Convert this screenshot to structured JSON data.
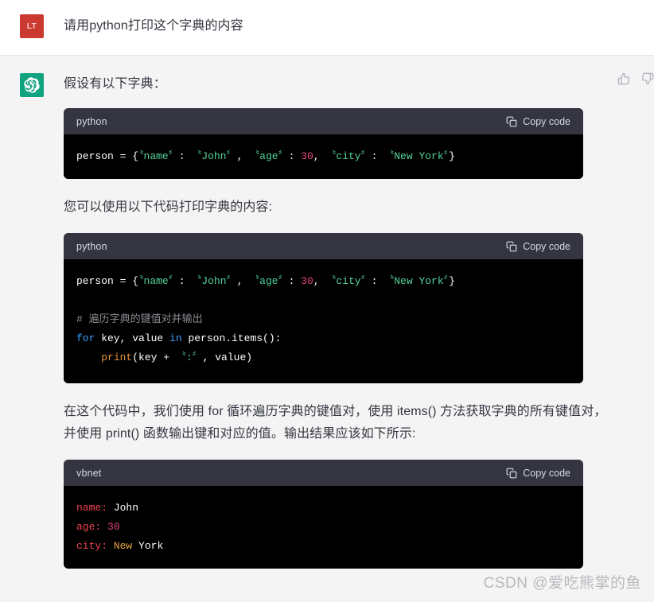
{
  "conversation": {
    "user_message": {
      "avatar_initials": "LT",
      "avatar_color": "#cb3a31",
      "text": "请用python打印这个字典的内容"
    },
    "assistant_message": {
      "avatar_color": "#10a37f",
      "avatar_icon": "openai-logo-icon",
      "intro_text": "假设有以下字典：",
      "middle_text": "您可以使用以下代码打印字典的内容:",
      "explanation_text": "在这个代码中，我们使用 for 循环遍历字典的键值对，使用 items() 方法获取字典的所有键值对，并使用 print() 函数输出键和对应的值。输出结果应该如下所示:",
      "feedback": {
        "thumbs_up": "thumbs-up-icon",
        "thumbs_down": "thumbs-down-icon"
      }
    }
  },
  "code_blocks": [
    {
      "language": "python",
      "copy_label": "Copy code",
      "copy_icon": "clipboard-icon",
      "lines": [
        [
          {
            "t": "person = {",
            "c": "tok-plain"
          },
          {
            "t": "〝name〞",
            "c": "tok-str"
          },
          {
            "t": ": ",
            "c": "tok-plain"
          },
          {
            "t": "〝John〞",
            "c": "tok-str"
          },
          {
            "t": ", ",
            "c": "tok-plain"
          },
          {
            "t": "〝age〞",
            "c": "tok-str"
          },
          {
            "t": ": ",
            "c": "tok-plain"
          },
          {
            "t": "30",
            "c": "tok-num"
          },
          {
            "t": ", ",
            "c": "tok-plain"
          },
          {
            "t": "〝city〞",
            "c": "tok-str"
          },
          {
            "t": ": ",
            "c": "tok-plain"
          },
          {
            "t": "〝New York〞",
            "c": "tok-str"
          },
          {
            "t": "}",
            "c": "tok-plain"
          }
        ]
      ]
    },
    {
      "language": "python",
      "copy_label": "Copy code",
      "copy_icon": "clipboard-icon",
      "lines": [
        [
          {
            "t": "person = {",
            "c": "tok-plain"
          },
          {
            "t": "〝name〞",
            "c": "tok-str"
          },
          {
            "t": ": ",
            "c": "tok-plain"
          },
          {
            "t": "〝John〞",
            "c": "tok-str"
          },
          {
            "t": ", ",
            "c": "tok-plain"
          },
          {
            "t": "〝age〞",
            "c": "tok-str"
          },
          {
            "t": ": ",
            "c": "tok-plain"
          },
          {
            "t": "30",
            "c": "tok-num"
          },
          {
            "t": ", ",
            "c": "tok-plain"
          },
          {
            "t": "〝city〞",
            "c": "tok-str"
          },
          {
            "t": ": ",
            "c": "tok-plain"
          },
          {
            "t": "〝New York〞",
            "c": "tok-str"
          },
          {
            "t": "}",
            "c": "tok-plain"
          }
        ],
        [],
        [
          {
            "t": "# 遍历字典的键值对并输出",
            "c": "tok-com"
          }
        ],
        [
          {
            "t": "for",
            "c": "tok-kw"
          },
          {
            "t": " key, value ",
            "c": "tok-plain"
          },
          {
            "t": "in",
            "c": "tok-kw"
          },
          {
            "t": " person.items():",
            "c": "tok-plain"
          }
        ],
        [
          {
            "t": "    ",
            "c": "tok-plain"
          },
          {
            "t": "print",
            "c": "tok-fn"
          },
          {
            "t": "(key + ",
            "c": "tok-plain"
          },
          {
            "t": "〝:〞",
            "c": "tok-str"
          },
          {
            "t": ", value)",
            "c": "tok-plain"
          }
        ]
      ]
    },
    {
      "language": "vbnet",
      "copy_label": "Copy code",
      "copy_icon": "clipboard-icon",
      "lines": [
        [
          {
            "t": "name:",
            "c": "tok-key"
          },
          {
            "t": " John",
            "c": "tok-plain"
          }
        ],
        [
          {
            "t": "age:",
            "c": "tok-key"
          },
          {
            "t": " ",
            "c": "tok-plain"
          },
          {
            "t": "30",
            "c": "tok-num2"
          }
        ],
        [
          {
            "t": "city:",
            "c": "tok-key"
          },
          {
            "t": " ",
            "c": "tok-plain"
          },
          {
            "t": "New",
            "c": "tok-org"
          },
          {
            "t": " York",
            "c": "tok-plain"
          }
        ]
      ]
    }
  ],
  "watermark": {
    "text": "CSDN @爱吃熊掌的鱼"
  }
}
